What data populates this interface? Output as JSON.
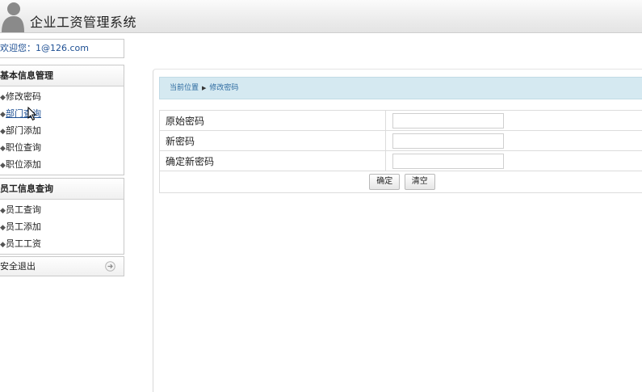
{
  "header": {
    "title": "企业工资管理系统"
  },
  "sidebar": {
    "welcome": "欢迎您：1@126.com",
    "sections": [
      {
        "title": "基本信息管理",
        "items": [
          "修改密码",
          "部门查询",
          "部门添加",
          "职位查询",
          "职位添加"
        ]
      },
      {
        "title": "员工信息查询",
        "items": [
          "员工查询",
          "员工添加",
          "员工工资"
        ]
      }
    ],
    "logout": "安全退出"
  },
  "main": {
    "breadcrumb": {
      "location": "当前位置",
      "current": "修改密码"
    },
    "form": {
      "fields": [
        {
          "label": "原始密码",
          "value": ""
        },
        {
          "label": "新密码",
          "value": ""
        },
        {
          "label": "确定新密码",
          "value": ""
        }
      ],
      "confirm_button": "确定",
      "clear_button": "清空"
    }
  }
}
